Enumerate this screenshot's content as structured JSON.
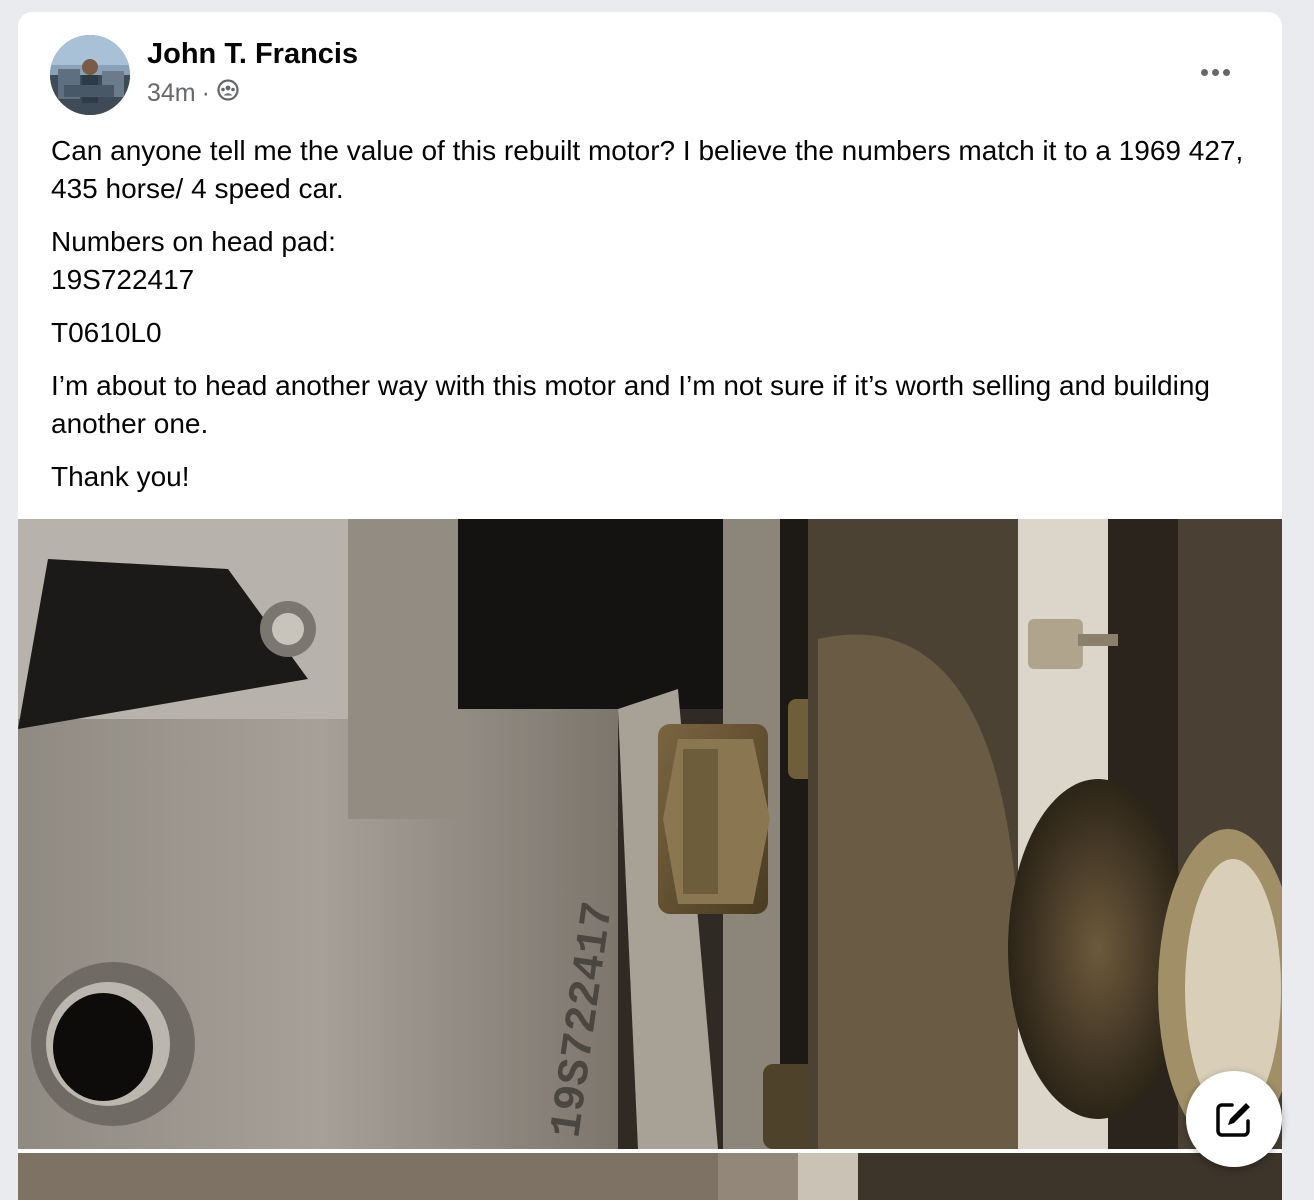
{
  "post": {
    "author": "John T. Francis",
    "time": "34m",
    "separator": "·",
    "audience_icon": "group-icon",
    "paragraphs": [
      "Can anyone tell me the value of this rebuilt motor? I believe the numbers match it to a 1969 427, 435 horse/ 4 speed car.",
      "Numbers on head pad:",
      "19S722417",
      "T0610L0",
      "I’m about to head another way with this motor and I’m not sure if it’s worth selling and building another one.",
      "Thank you!"
    ],
    "photo_stamp": "19S722417"
  },
  "icons": {
    "more": "more-options-icon",
    "compose": "compose-icon"
  }
}
